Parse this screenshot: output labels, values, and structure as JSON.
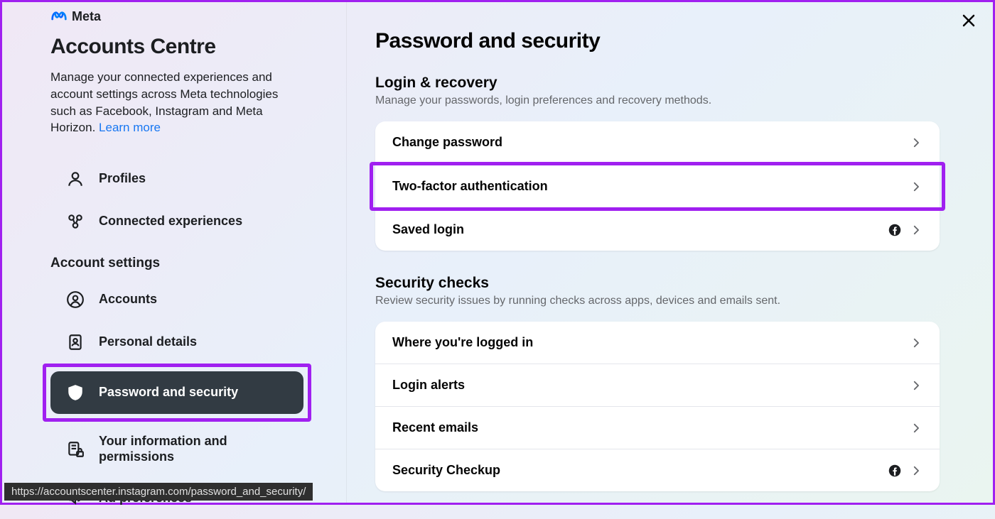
{
  "logo_text": "Meta",
  "close_label": "Close",
  "sidebar": {
    "title": "Accounts Centre",
    "description": "Manage your connected experiences and account settings across Meta technologies such as Facebook, Instagram and Meta Horizon. ",
    "learn_more": "Learn more",
    "top_items": [
      {
        "label": "Profiles"
      },
      {
        "label": "Connected experiences"
      }
    ],
    "section_heading": "Account settings",
    "settings_items": [
      {
        "label": "Accounts"
      },
      {
        "label": "Personal details"
      },
      {
        "label": "Password and security"
      },
      {
        "label": "Your information and permissions"
      },
      {
        "label": "Ad preferences"
      }
    ]
  },
  "main": {
    "title": "Password and security",
    "sections": [
      {
        "title": "Login & recovery",
        "desc": "Manage your passwords, login preferences and recovery methods.",
        "rows": [
          {
            "label": "Change password"
          },
          {
            "label": "Two-factor authentication"
          },
          {
            "label": "Saved login"
          }
        ]
      },
      {
        "title": "Security checks",
        "desc": "Review security issues by running checks across apps, devices and emails sent.",
        "rows": [
          {
            "label": "Where you're logged in"
          },
          {
            "label": "Login alerts"
          },
          {
            "label": "Recent emails"
          },
          {
            "label": "Security Checkup"
          }
        ]
      }
    ]
  },
  "url_bar": "https://accountscenter.instagram.com/password_and_security/",
  "highlight": {
    "sidebar_index": 2,
    "main_section": 0,
    "main_row": 1
  },
  "colors": {
    "accent": "#1877f2",
    "highlight": "#a020f0",
    "sidebar_active_bg": "#323b43"
  }
}
